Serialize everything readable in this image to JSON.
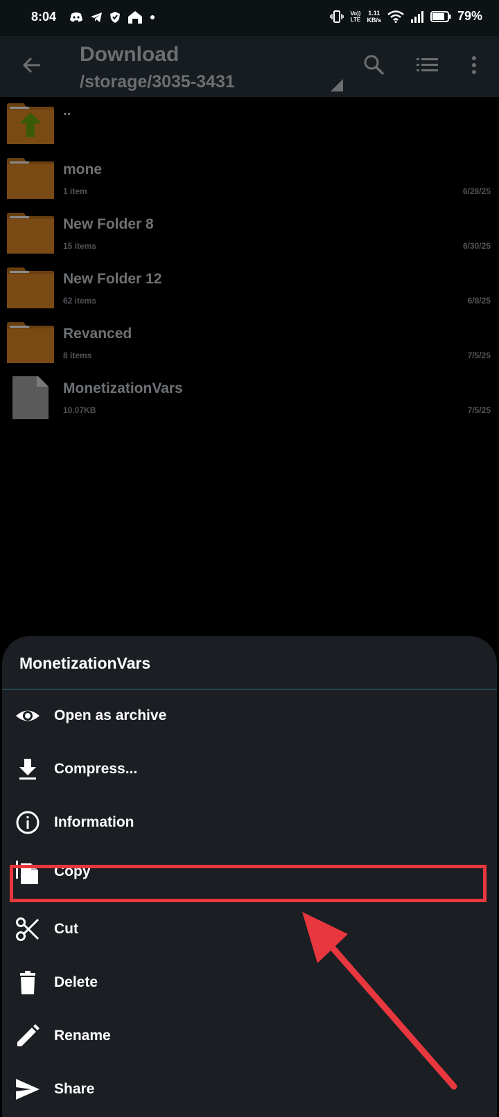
{
  "status_bar": {
    "time": "8:04",
    "network_speed": "1.11",
    "network_speed_unit": "KB/s",
    "volte_line1": "Vo))",
    "volte_line2": "LTE",
    "battery": "79%"
  },
  "app_bar": {
    "title": "Download",
    "path": "/storage/3035-3431"
  },
  "files": [
    {
      "name": "..",
      "meta": "",
      "date": "",
      "type": "parent"
    },
    {
      "name": "mone",
      "meta": "1 item",
      "date": "6/28/25",
      "type": "folder"
    },
    {
      "name": "New Folder 8",
      "meta": "15 items",
      "date": "6/30/25",
      "type": "folder"
    },
    {
      "name": "New Folder 12",
      "meta": "62 items",
      "date": "6/8/25",
      "type": "folder"
    },
    {
      "name": "Revanced",
      "meta": "8 items",
      "date": "7/5/25",
      "type": "folder"
    },
    {
      "name": "MonetizationVars",
      "meta": "10.07KB",
      "date": "7/5/25",
      "type": "file"
    }
  ],
  "sheet": {
    "title": "MonetizationVars",
    "items": [
      {
        "label": "Open as archive",
        "icon": "eye-icon"
      },
      {
        "label": "Compress...",
        "icon": "download-icon"
      },
      {
        "label": "Information",
        "icon": "info-icon"
      },
      {
        "label": "Copy",
        "icon": "copy-icon"
      },
      {
        "label": "Cut",
        "icon": "scissors-icon"
      },
      {
        "label": "Delete",
        "icon": "trash-icon"
      },
      {
        "label": "Rename",
        "icon": "pencil-icon"
      },
      {
        "label": "Share",
        "icon": "send-icon"
      }
    ]
  },
  "colors": {
    "highlight": "#e8373e",
    "accent_divider": "#2f7c87",
    "folder": "#7a4a14"
  }
}
